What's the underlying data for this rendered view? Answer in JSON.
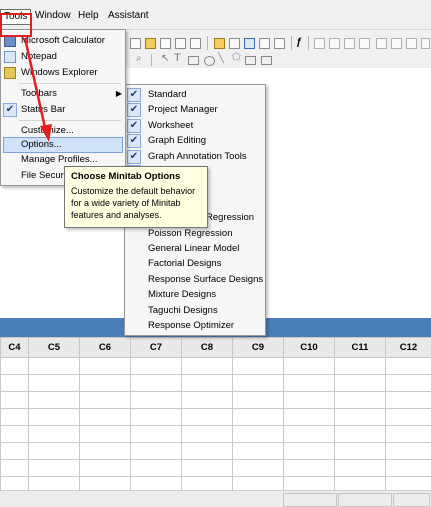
{
  "menubar": {
    "tools": "Tools",
    "window": "Window",
    "help": "Help",
    "assistant": "Assistant"
  },
  "tools_menu": {
    "items": [
      {
        "label": "Microsoft Calculator",
        "icon": "calculator-icon"
      },
      {
        "label": "Notepad",
        "icon": "notepad-icon"
      },
      {
        "label": "Windows Explorer",
        "icon": "folder-icon"
      },
      {
        "label": "Toolbars"
      },
      {
        "label": "Status Bar",
        "checked": true
      },
      {
        "label": "Customize..."
      },
      {
        "label": "Options..."
      },
      {
        "label": "Manage Profiles..."
      },
      {
        "label": "File Security..."
      }
    ]
  },
  "toolbars_submenu": {
    "items": [
      {
        "label": "Standard",
        "checked": true
      },
      {
        "label": "Project Manager",
        "checked": true
      },
      {
        "label": "Worksheet",
        "checked": true
      },
      {
        "label": "Graph Editing",
        "checked": true
      },
      {
        "label": "Graph Annotation Tools",
        "checked": true
      },
      {
        "label": "",
        "checked": true
      },
      {
        "label": "",
        "checked": false
      },
      {
        "label": "",
        "checked": false
      },
      {
        "label": "Regression",
        "checked": false
      },
      {
        "label": "Poisson Regression",
        "checked": false
      },
      {
        "label": "General Linear Model",
        "checked": false
      },
      {
        "label": "Factorial Designs",
        "checked": false
      },
      {
        "label": "Response Surface Designs",
        "checked": false
      },
      {
        "label": "Mixture Designs",
        "checked": false
      },
      {
        "label": "Taguchi Designs",
        "checked": false
      },
      {
        "label": "Response Optimizer",
        "checked": false
      }
    ]
  },
  "tooltip": {
    "title": "Choose Minitab Options",
    "body": "Customize the default behavior for a wide variety of Minitab features and analyses."
  },
  "worksheet": {
    "columns": [
      "C4",
      "C5",
      "C6",
      "C7",
      "C8",
      "C9",
      "C10",
      "C11",
      "C12"
    ]
  },
  "colors": {
    "accent_bar": "#4a7ebb",
    "highlight": "#cfe2f8",
    "annotation": "#e02020",
    "tooltip_bg": "#ffffe1"
  }
}
